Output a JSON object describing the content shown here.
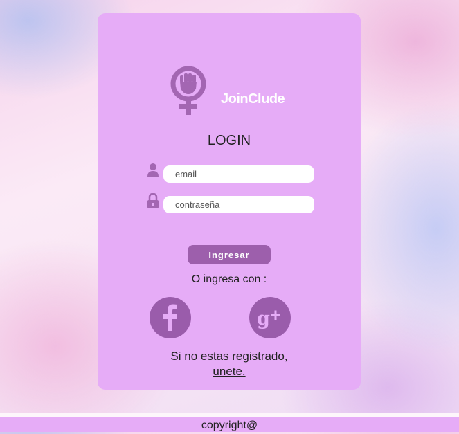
{
  "brand": {
    "name": "JoinClude",
    "logo_icon": "feminist-fist-icon"
  },
  "login": {
    "title": "LOGIN",
    "email_placeholder": "email",
    "password_placeholder": "contraseña",
    "email_icon": "user-icon",
    "password_icon": "lock-icon",
    "submit_label": "Ingresar"
  },
  "social": {
    "prompt": "O ingresa con :",
    "facebook_icon": "facebook-icon",
    "google_icon": "google-plus-icon"
  },
  "register": {
    "text": "Si no estas registrado,",
    "link": "unete."
  },
  "footer": {
    "text": "copyright@"
  },
  "colors": {
    "card": "#e6acf7",
    "accent": "#9d5fac",
    "icon": "#a366b2",
    "footer": "#e6acf7"
  }
}
